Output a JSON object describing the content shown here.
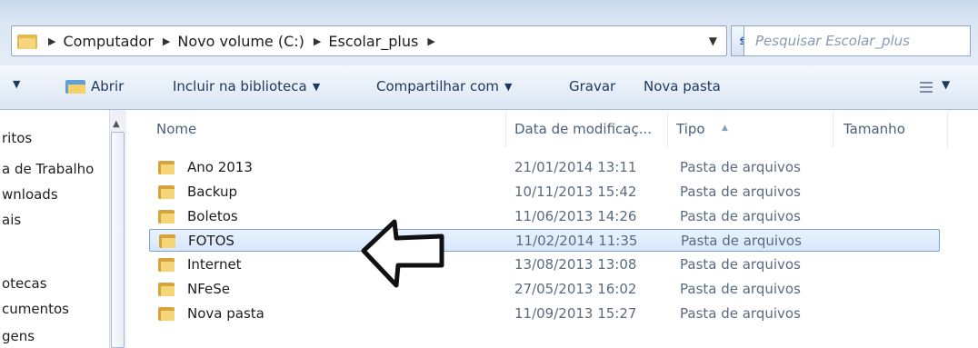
{
  "address": {
    "crumbs": [
      "Computador",
      "Novo volume (C:)",
      "Escolar_plus"
    ],
    "search_placeholder": "Pesquisar Escolar_plus"
  },
  "toolbar": {
    "open": "Abrir",
    "include_library": "Incluir na biblioteca",
    "share": "Compartilhar com",
    "burn": "Gravar",
    "new_folder": "Nova pasta"
  },
  "nav": {
    "items": [
      "ritos",
      "a de Trabalho",
      "wnloads",
      "ais",
      "otecas",
      "cumentos",
      "gens"
    ]
  },
  "columns": {
    "name": "Nome",
    "date": "Data de modificaç...",
    "type": "Tipo",
    "size": "Tamanho"
  },
  "files": [
    {
      "name": "Ano 2013",
      "date": "21/01/2014 13:11",
      "type": "Pasta de arquivos"
    },
    {
      "name": "Backup",
      "date": "10/11/2013 15:42",
      "type": "Pasta de arquivos"
    },
    {
      "name": "Boletos",
      "date": "11/06/2013 14:26",
      "type": "Pasta de arquivos"
    },
    {
      "name": "FOTOS",
      "date": "11/02/2014 11:35",
      "type": "Pasta de arquivos"
    },
    {
      "name": "Internet",
      "date": "13/08/2013 13:08",
      "type": "Pasta de arquivos"
    },
    {
      "name": "NFeSe",
      "date": "27/05/2013 16:02",
      "type": "Pasta de arquivos"
    },
    {
      "name": "Nova pasta",
      "date": "11/09/2013 15:27",
      "type": "Pasta de arquivos"
    }
  ],
  "selected_file": "FOTOS",
  "icons": {
    "folder": "folder-icon",
    "open": "open-folder-icon",
    "refresh": "refresh-icon",
    "view": "view-options-icon",
    "annotation": "left-arrow-icon"
  },
  "colors": {
    "selection_border": "#7da2ce",
    "toolbar_text": "#1e395b"
  }
}
